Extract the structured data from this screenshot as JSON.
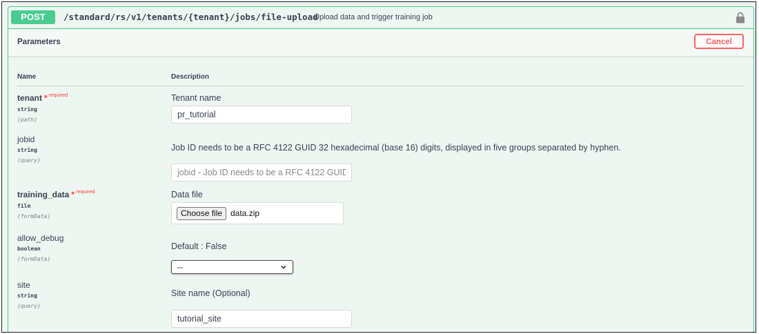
{
  "operation": {
    "method": "POST",
    "path": "/standard/rs/v1/tenants/{tenant}/jobs/file-upload",
    "summary": "Upload data and trigger training job",
    "lock_icon": "lock-icon"
  },
  "parameters_section": {
    "title": "Parameters",
    "cancel_label": "Cancel",
    "col_name": "Name",
    "col_description": "Description"
  },
  "params": [
    {
      "name": "tenant",
      "required_marker": "*",
      "required_text": "required",
      "type": "string",
      "in": "(path)",
      "description": "Tenant name",
      "value": "pr_tutorial"
    },
    {
      "name": "jobid",
      "type": "string",
      "in": "(query)",
      "description": "Job ID needs to be a RFC 4122 GUID 32 hexadecimal (base 16) digits, displayed in five groups separated by hyphen.",
      "placeholder": "jobid - Job ID needs to be a RFC 4122 GUID"
    },
    {
      "name": "training_data",
      "required_marker": "*",
      "required_text": "required",
      "type": "file",
      "in": "(formData)",
      "description": "Data file",
      "button_label": "Choose file",
      "file_name": "data.zip"
    },
    {
      "name": "allow_debug",
      "type": "boolean",
      "in": "(formData)",
      "description": "Default : False",
      "selected": "--"
    },
    {
      "name": "site",
      "type": "string",
      "in": "(query)",
      "description": "Site name (Optional)",
      "value": "tutorial_site"
    }
  ],
  "colors": {
    "post_green": "#49cc90",
    "required_red": "#ff3d3d",
    "background": "#edf6f1"
  }
}
